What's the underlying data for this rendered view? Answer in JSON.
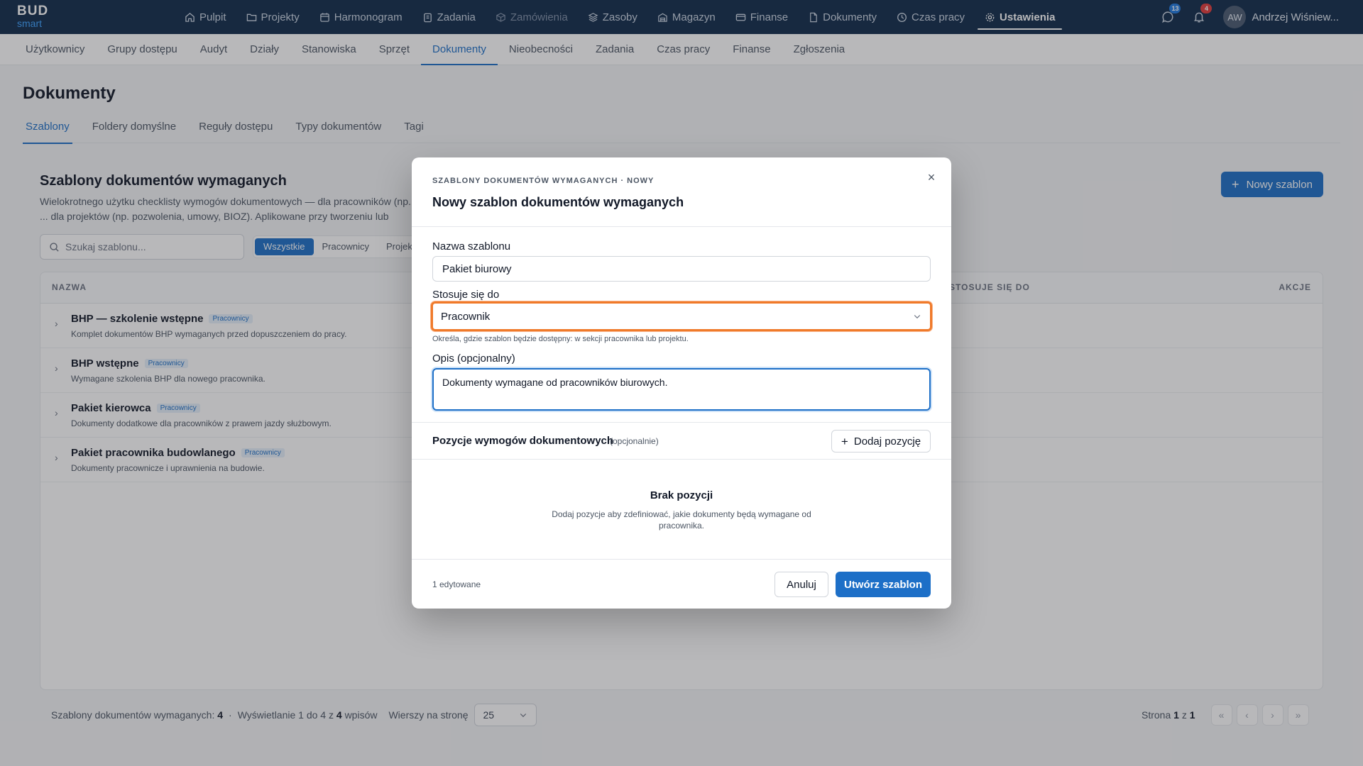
{
  "app": {
    "logo_top": "BUD",
    "logo_bottom": "smart"
  },
  "topnav": {
    "items": [
      {
        "label": "Pulpit",
        "icon": "home-icon"
      },
      {
        "label": "Projekty",
        "icon": "folder-icon"
      },
      {
        "label": "Harmonogram",
        "icon": "calendar-icon"
      },
      {
        "label": "Zadania",
        "icon": "clipboard-icon"
      },
      {
        "label": "Zamówienia",
        "icon": "box-icon"
      },
      {
        "label": "Zasoby",
        "icon": "layers-icon"
      },
      {
        "label": "Magazyn",
        "icon": "warehouse-icon"
      },
      {
        "label": "Finanse",
        "icon": "card-icon"
      },
      {
        "label": "Dokumenty",
        "icon": "document-icon"
      },
      {
        "label": "Czas pracy",
        "icon": "clock-icon"
      },
      {
        "label": "Ustawienia",
        "icon": "gear-icon"
      }
    ],
    "messages_count": "13",
    "notifications_count": "4",
    "avatar_initials": "AW",
    "user_name": "Andrzej Wiśniew..."
  },
  "subnav": {
    "items": [
      "Użytkownicy",
      "Grupy dostępu",
      "Audyt",
      "Działy",
      "Stanowiska",
      "Sprzęt",
      "Dokumenty",
      "Nieobecności",
      "Zadania",
      "Czas pracy",
      "Finanse",
      "Zgłoszenia"
    ]
  },
  "page": {
    "title": "Dokumenty",
    "tabs": [
      "Szablony",
      "Foldery domyślne",
      "Reguły dostępu",
      "Typy dokumentów",
      "Tagi"
    ]
  },
  "section": {
    "title": "Szablony dokumentów wymaganych",
    "desc": "Wielokrotnego użytku checklisty wymogów dokumentowych — dla pracowników (np. ... dla projektów (np. pozwolenia, umowy, BIOZ). Aplikowane przy tworzeniu lub edycji.",
    "new_button": "Nowy szablon",
    "search_placeholder": "Szukaj szablonu...",
    "filters": [
      "Wszystkie",
      "Pracownicy",
      "Projekty"
    ]
  },
  "table": {
    "headers": {
      "name": "NAZWA",
      "applies": "STOSUJE SIĘ DO",
      "actions": "AKCJE"
    },
    "rows": [
      {
        "name": "BHP — szkolenie wstępne",
        "tag": "Pracownicy",
        "desc": "Komplet dokumentów BHP wymaganych przed dopuszczeniem do pracy."
      },
      {
        "name": "BHP wstępne",
        "tag": "Pracownicy",
        "desc": "Wymagane szkolenia BHP dla nowego pracownika."
      },
      {
        "name": "Pakiet kierowca",
        "tag": "Pracownicy",
        "desc": "Dokumenty dodatkowe dla pracowników z prawem jazdy służbowym."
      },
      {
        "name": "Pakiet pracownika budowlanego",
        "tag": "Pracownicy",
        "desc": "Dokumenty pracownicze i uprawnienia na budowie."
      }
    ]
  },
  "footer": {
    "count_label": "Szablony dokumentów wymaganych:",
    "count": "4",
    "showing_prefix": "Wyświetlanie 1 do 4 z",
    "showing_total": "4",
    "showing_suffix": "wpisów",
    "rows_per_page_label": "Wierszy na stronę",
    "rows_per_page": "25",
    "page_label": "Strona",
    "page_current": "1",
    "page_of": "z",
    "page_total": "1"
  },
  "modal": {
    "eyebrow": "SZABLONY DOKUMENTÓW WYMAGANYCH · NOWY",
    "title": "Nowy szablon dokumentów wymaganych",
    "name_label": "Nazwa szablonu",
    "name_value": "Pakiet biurowy",
    "applies_label": "Stosuje się do",
    "applies_value": "Pracownik",
    "applies_hint": "Określa, gdzie szablon będzie dostępny: w sekcji pracownika lub projektu.",
    "desc_label": "Opis (opcjonalny)",
    "desc_value": "Dokumenty wymagane od pracowników biurowych.",
    "positions_title": "Pozycje wymogów dokumentowych",
    "positions_optional": "(opcjonalnie)",
    "add_position": "Dodaj pozycję",
    "empty_title": "Brak pozycji",
    "empty_desc": "Dodaj pozycje aby zdefiniować, jakie dokumenty będą wymagane od pracownika.",
    "edited_note": "1 edytowane",
    "cancel": "Anuluj",
    "create": "Utwórz szablon"
  },
  "colors": {
    "nav_bg": "#0f2a4a",
    "accent": "#1d6fc7",
    "focus_orange": "#f07a2a"
  }
}
